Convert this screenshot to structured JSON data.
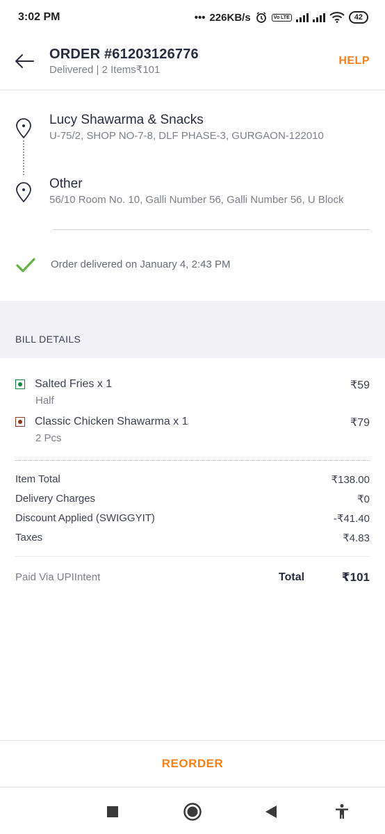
{
  "status_bar": {
    "time": "3:02 PM",
    "net_speed": "226KB/s",
    "volte": "Vo LTE",
    "battery": "42"
  },
  "header": {
    "title": "ORDER #61203126776",
    "subtitle": "Delivered | 2 Items₹101",
    "help": "HELP"
  },
  "restaurant": {
    "name": "Lucy Shawarma & Snacks",
    "address": "U-75/2, SHOP NO-7-8, DLF PHASE-3, GURGAON-122010"
  },
  "destination": {
    "name": "Other",
    "address": "56/10 Room No. 10, Galli Number 56, Galli Number 56, U Block"
  },
  "delivery_status": "Order delivered on January 4, 2:43 PM",
  "bill": {
    "heading": "BILL DETAILS",
    "items": [
      {
        "name": "Salted Fries x 1",
        "variant": "Half",
        "price": "₹59",
        "indicator_color": "#0f8a3c"
      },
      {
        "name": "Classic Chicken Shawarma x 1",
        "variant": "2 Pcs",
        "price": "₹79",
        "indicator_color": "#8b3a1c"
      }
    ],
    "charges": [
      {
        "label": "Item Total",
        "value": "₹138.00"
      },
      {
        "label": "Delivery Charges",
        "value": "₹0"
      },
      {
        "label": "Discount Applied (SWIGGYIT)",
        "value": "-₹41.40"
      },
      {
        "label": "Taxes",
        "value": "₹4.83"
      }
    ],
    "paid_via": "Paid Via UPIIntent",
    "total_label": "Total",
    "total_value": "₹101"
  },
  "reorder": "REORDER",
  "colors": {
    "accent": "#fc8019",
    "success": "#60b246"
  }
}
